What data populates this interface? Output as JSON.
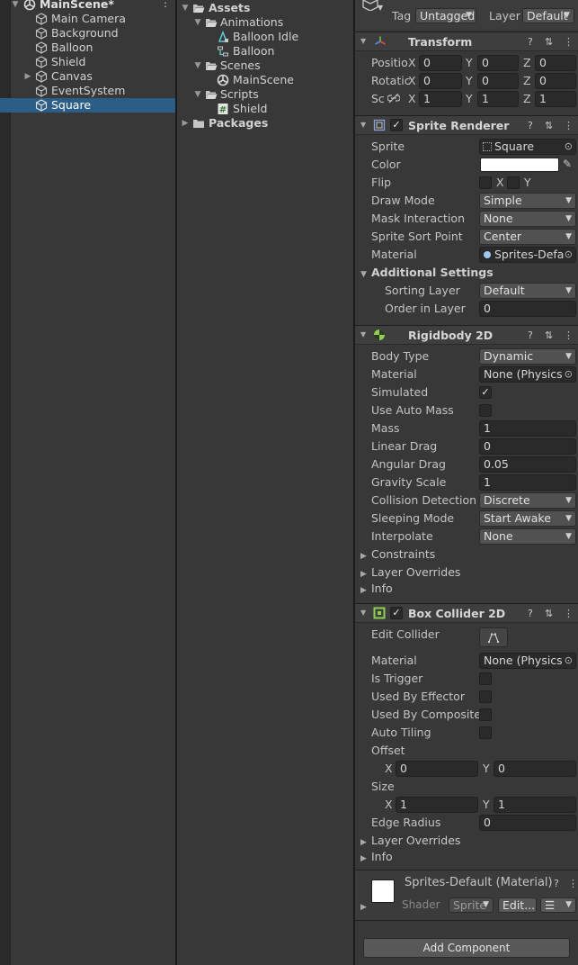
{
  "hierarchy": {
    "scene_name": "MainScene*",
    "items": [
      {
        "label": "Main Camera"
      },
      {
        "label": "Background"
      },
      {
        "label": "Balloon"
      },
      {
        "label": "Shield"
      },
      {
        "label": "Canvas"
      },
      {
        "label": "EventSystem"
      },
      {
        "label": "Square"
      }
    ],
    "selected": "Square"
  },
  "project": {
    "root": "Assets",
    "animations_folder": "Animations",
    "balloon_idle": "Balloon Idle",
    "balloon_controller": "Balloon",
    "scenes_folder": "Scenes",
    "main_scene": "MainScene",
    "scripts_folder": "Scripts",
    "shield_script": "Shield",
    "packages": "Packages"
  },
  "inspector": {
    "tag_label": "Tag",
    "tag_value": "Untagged",
    "layer_label": "Layer",
    "layer_value": "Default",
    "transform": {
      "title": "Transform",
      "position_label": "Positio",
      "rotation_label": "Rotatic",
      "scale_label": "Sc",
      "axis_x": "X",
      "axis_y": "Y",
      "axis_z": "Z",
      "position": [
        "0",
        "0",
        "0"
      ],
      "rotation": [
        "0",
        "0",
        "0"
      ],
      "scale": [
        "1",
        "1",
        "1"
      ]
    },
    "sprite_renderer": {
      "title": "Sprite Renderer",
      "sprite_label": "Sprite",
      "sprite_value": "Square",
      "color_label": "Color",
      "color_value": "#ffffff",
      "flip_label": "Flip",
      "flip_x": "X",
      "flip_y": "Y",
      "draw_mode_label": "Draw Mode",
      "draw_mode_value": "Simple",
      "mask_label": "Mask Interaction",
      "mask_value": "None",
      "sort_point_label": "Sprite Sort Point",
      "sort_point_value": "Center",
      "material_label": "Material",
      "material_value": "Sprites-Defa",
      "additional_label": "Additional Settings",
      "sorting_layer_label": "Sorting Layer",
      "sorting_layer_value": "Default",
      "order_label": "Order in Layer",
      "order_value": "0"
    },
    "rigidbody": {
      "title": "Rigidbody 2D",
      "body_type_label": "Body Type",
      "body_type_value": "Dynamic",
      "material_label": "Material",
      "material_value": "None (Physics",
      "simulated_label": "Simulated",
      "auto_mass_label": "Use Auto Mass",
      "mass_label": "Mass",
      "mass_value": "1",
      "linear_drag_label": "Linear Drag",
      "linear_drag_value": "0",
      "angular_drag_label": "Angular Drag",
      "angular_drag_value": "0.05",
      "gravity_label": "Gravity Scale",
      "gravity_value": "1",
      "collision_label": "Collision Detection",
      "collision_value": "Discrete",
      "sleeping_label": "Sleeping Mode",
      "sleeping_value": "Start Awake",
      "interpolate_label": "Interpolate",
      "interpolate_value": "None",
      "constraints_label": "Constraints",
      "layer_overrides_label": "Layer Overrides",
      "info_label": "Info"
    },
    "box_collider": {
      "title": "Box Collider 2D",
      "edit_collider_label": "Edit Collider",
      "material_label": "Material",
      "material_value": "None (Physics",
      "is_trigger_label": "Is Trigger",
      "used_effector_label": "Used By Effector",
      "used_composite_label": "Used By Composite",
      "auto_tiling_label": "Auto Tiling",
      "offset_label": "Offset",
      "offset_x": "0",
      "offset_y": "0",
      "size_label": "Size",
      "size_x": "1",
      "size_y": "1",
      "axis_x": "X",
      "axis_y": "Y",
      "edge_radius_label": "Edge Radius",
      "edge_radius_value": "0",
      "layer_overrides_label": "Layer Overrides",
      "info_label": "Info"
    },
    "material_asset": {
      "title": "Sprites-Default (Material)",
      "shader_label": "Shader",
      "shader_value": "Sprite",
      "edit_label": "Edit..."
    },
    "add_component_label": "Add Component"
  },
  "colors": {
    "selection": "#2c5d87",
    "panel": "#383838",
    "field": "#2a2a2a"
  }
}
